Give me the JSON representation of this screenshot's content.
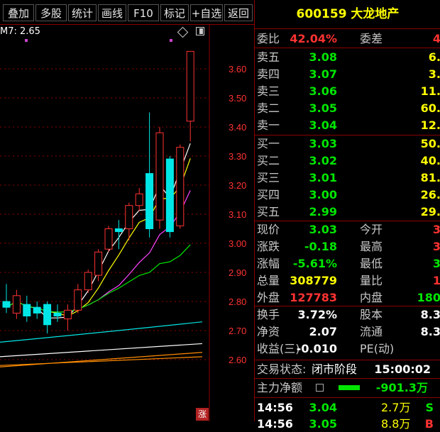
{
  "toolbar": {
    "buttons": [
      "叠加",
      "多股",
      "统计",
      "画线",
      "F10",
      "标记",
      "+自选",
      "返回"
    ]
  },
  "chart": {
    "ma_label": "M7: 2.65",
    "badge": "涨",
    "price_ticks": [
      "3.60",
      "3.50",
      "3.40",
      "3.30",
      "3.20",
      "3.10",
      "3.00",
      "2.90",
      "2.80",
      "2.70",
      "2.60"
    ]
  },
  "chart_data": {
    "type": "candlestick",
    "ylim": [
      2.57,
      3.67
    ],
    "candles": [
      {
        "o": 2.8,
        "c": 2.78,
        "h": 2.86,
        "l": 2.76
      },
      {
        "o": 2.76,
        "c": 2.82,
        "h": 2.84,
        "l": 2.74
      },
      {
        "o": 2.79,
        "c": 2.75,
        "h": 2.82,
        "l": 2.73
      },
      {
        "o": 2.78,
        "c": 2.76,
        "h": 2.8,
        "l": 2.74
      },
      {
        "o": 2.79,
        "c": 2.72,
        "h": 2.8,
        "l": 2.69
      },
      {
        "o": 2.76,
        "c": 2.75,
        "h": 2.79,
        "l": 2.73
      },
      {
        "o": 2.74,
        "c": 2.77,
        "h": 2.79,
        "l": 2.7
      },
      {
        "o": 2.77,
        "c": 2.84,
        "h": 2.86,
        "l": 2.76
      },
      {
        "o": 2.84,
        "c": 2.9,
        "h": 2.91,
        "l": 2.83
      },
      {
        "o": 2.89,
        "c": 2.97,
        "h": 2.98,
        "l": 2.87
      },
      {
        "o": 2.98,
        "c": 3.05,
        "h": 3.06,
        "l": 2.97
      },
      {
        "o": 3.05,
        "c": 3.04,
        "h": 3.08,
        "l": 2.98
      },
      {
        "o": 3.05,
        "c": 3.13,
        "h": 3.14,
        "l": 3.01
      },
      {
        "o": 3.13,
        "c": 3.17,
        "h": 3.19,
        "l": 3.11
      },
      {
        "o": 3.24,
        "c": 3.05,
        "h": 3.45,
        "l": 3.02
      },
      {
        "o": 3.08,
        "c": 3.38,
        "h": 3.4,
        "l": 3.05
      },
      {
        "o": 3.29,
        "c": 3.04,
        "h": 3.3,
        "l": 3.02
      },
      {
        "o": 3.06,
        "c": 3.33,
        "h": 3.34,
        "l": 3.05
      },
      {
        "o": 3.42,
        "c": 3.66,
        "h": 3.66,
        "l": 3.35
      }
    ]
  },
  "quote": {
    "title": "600159 大龙地产",
    "weibi_label": "委比",
    "weibi_value": "42.04%",
    "weicha_label": "委差",
    "weicha_value": "4",
    "sells": [
      {
        "label": "卖五",
        "price": "3.08",
        "vol": "6."
      },
      {
        "label": "卖四",
        "price": "3.07",
        "vol": "3."
      },
      {
        "label": "卖三",
        "price": "3.06",
        "vol": "11."
      },
      {
        "label": "卖二",
        "price": "3.05",
        "vol": "60."
      },
      {
        "label": "卖一",
        "price": "3.04",
        "vol": "12."
      }
    ],
    "buys": [
      {
        "label": "买一",
        "price": "3.03",
        "vol": "50."
      },
      {
        "label": "买二",
        "price": "3.02",
        "vol": "40."
      },
      {
        "label": "买三",
        "price": "3.01",
        "vol": "81."
      },
      {
        "label": "买四",
        "price": "3.00",
        "vol": "26."
      },
      {
        "label": "买五",
        "price": "2.99",
        "vol": "29."
      }
    ],
    "stats": [
      {
        "l1": "现价",
        "v1": "3.03",
        "l2": "今开",
        "v2": "3"
      },
      {
        "l1": "涨跌",
        "v1": "-0.18",
        "l2": "最高",
        "v2": "3"
      },
      {
        "l1": "涨幅",
        "v1": "-5.61%",
        "l2": "最低",
        "v2": "3"
      },
      {
        "l1": "总量",
        "v1": "308779",
        "l2": "量比",
        "v2": "1"
      },
      {
        "l1": "外盘",
        "v1": "127783",
        "l2": "内盘",
        "v2": "180"
      }
    ],
    "fin": [
      {
        "l1": "换手",
        "v1": "3.72%",
        "l2": "股本",
        "v2": "8.3"
      },
      {
        "l1": "净资",
        "v1": "2.07",
        "l2": "流通",
        "v2": "8.3"
      },
      {
        "l1": "收益(三)",
        "v1": "-0.010",
        "l2": "PE(动)",
        "v2": ""
      }
    ],
    "status_label": "交易状态:",
    "status_value": "闭市阶段",
    "status_time": "15:00:02",
    "netflow_label": "主力净额",
    "netflow_value": "-901.3万",
    "ticks": [
      {
        "time": "14:56",
        "price": "3.04",
        "vol": "2.7万",
        "bs": "S"
      },
      {
        "time": "14:56",
        "price": "3.05",
        "vol": "8.8万",
        "bs": "B"
      }
    ]
  }
}
